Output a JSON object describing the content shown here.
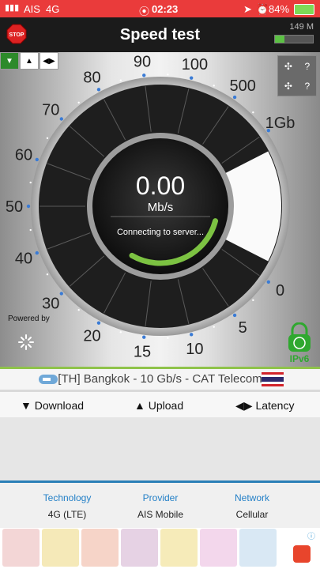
{
  "status": {
    "carrier": "AIS",
    "network": "4G",
    "time": "02:23",
    "battery": "84%"
  },
  "app": {
    "title": "Speed test",
    "memory": "149 M",
    "memory_level": 0.25,
    "stop_label": "STOP"
  },
  "gauge": {
    "value": "0.00",
    "unit": "Mb/s",
    "status": "Connecting to server...",
    "ticks": [
      "0",
      "5",
      "10",
      "15",
      "20",
      "30",
      "40",
      "50",
      "60",
      "70",
      "80",
      "90",
      "100",
      "500",
      "1Gb"
    ]
  },
  "badges": {
    "powered_by": "Powered by",
    "ipv6": "IPv6",
    "help": "?"
  },
  "server": {
    "label": "[TH] Bangkok - 10 Gb/s - CAT Telecom"
  },
  "tabs": {
    "download": "Download",
    "upload": "Upload",
    "latency": "Latency"
  },
  "info": {
    "technology_label": "Technology",
    "technology_value": "4G (LTE)",
    "provider_label": "Provider",
    "provider_value": "AIS Mobile",
    "network_label": "Network",
    "network_value": "Cellular"
  },
  "colors": {
    "status_bar": "#ea3b3b",
    "accent_green": "#7cc242",
    "accent_blue": "#2480c7"
  }
}
